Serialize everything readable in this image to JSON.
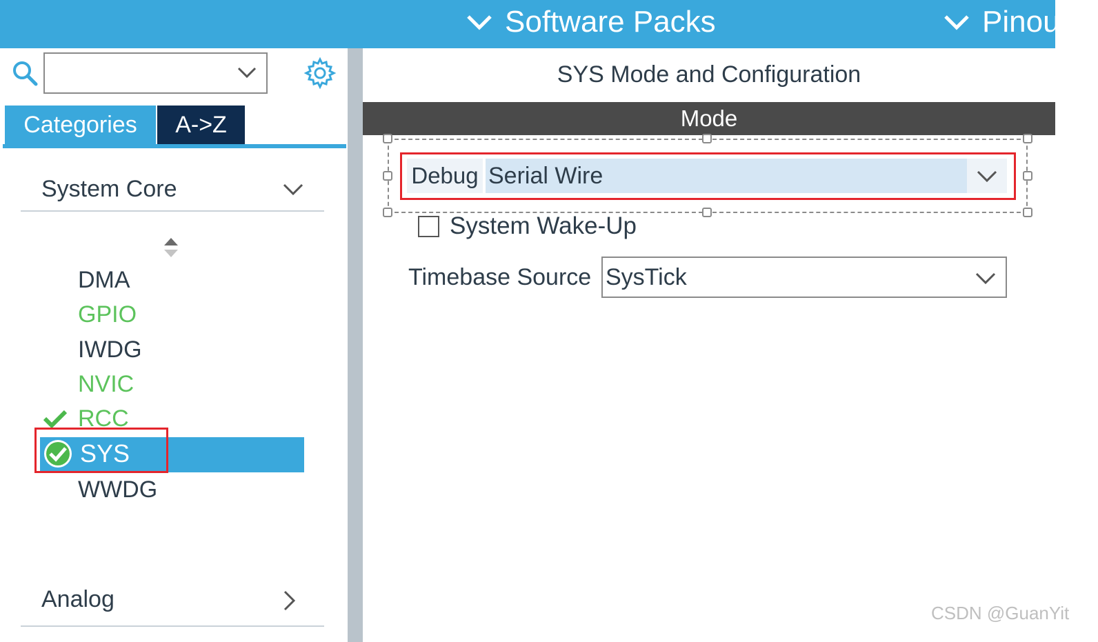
{
  "top_bar": {
    "menus": [
      {
        "label": "Software Packs",
        "icon": "chevron-down-icon"
      },
      {
        "label": "Pinou",
        "icon": "chevron-down-icon"
      }
    ],
    "color": "#3aa8dc"
  },
  "left_panel": {
    "search": {
      "value": "",
      "placeholder": ""
    },
    "icons": [
      "search-icon",
      "gear-icon",
      "sort-icon"
    ],
    "tabs": [
      {
        "label": "Categories",
        "active": true
      },
      {
        "label": "A->Z",
        "active": false
      }
    ],
    "sections": [
      {
        "label": "System Core",
        "expanded": true
      },
      {
        "label": "Analog",
        "expanded": false
      }
    ],
    "system_core_items": [
      {
        "label": "DMA",
        "color": "#2e3d4a"
      },
      {
        "label": "GPIO",
        "color": "#5cc35c"
      },
      {
        "label": "IWDG",
        "color": "#2e3d4a"
      },
      {
        "label": "NVIC",
        "color": "#5cc35c"
      },
      {
        "label": "RCC",
        "color": "#5cc35c",
        "status": "check-icon"
      },
      {
        "label": "SYS",
        "selected": true,
        "status": "check-circle-icon"
      },
      {
        "label": "WWDG",
        "color": "#2e3d4a"
      }
    ]
  },
  "config": {
    "title": "SYS Mode and Configuration",
    "mode_header": "Mode",
    "debug": {
      "label": "Debug",
      "value": "Serial Wire"
    },
    "wake_up": {
      "label": "System Wake-Up",
      "checked": false
    },
    "timebase": {
      "label": "Timebase Source",
      "value": "SysTick"
    }
  },
  "watermark": "CSDN @GuanYit",
  "colors": {
    "accent": "#3aa8dc",
    "dark_tab": "#0f2c4f",
    "highlight": "#e4252c",
    "ok_green": "#5cc35c"
  }
}
